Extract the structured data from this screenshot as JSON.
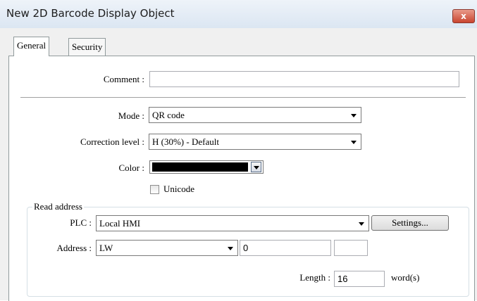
{
  "window": {
    "title": "New 2D Barcode Display Object",
    "close_label": "x"
  },
  "tabs": [
    {
      "label": "General"
    },
    {
      "label": "Security"
    }
  ],
  "form": {
    "comment_label": "Comment :",
    "comment_value": "",
    "mode_label": "Mode :",
    "mode_value": "QR code",
    "correction_label": "Correction level :",
    "correction_value": "H (30%) - Default",
    "color_label": "Color :",
    "color_value": "#000000",
    "unicode_label": "Unicode",
    "unicode_checked": false
  },
  "read_address": {
    "legend": "Read address",
    "plc_label": "PLC :",
    "plc_value": "Local HMI",
    "settings_label": "Settings...",
    "address_label": "Address :",
    "address_type": "LW",
    "address_value": "0",
    "address_extra": "",
    "length_label": "Length :",
    "length_value": "16",
    "length_unit": "word(s)"
  }
}
